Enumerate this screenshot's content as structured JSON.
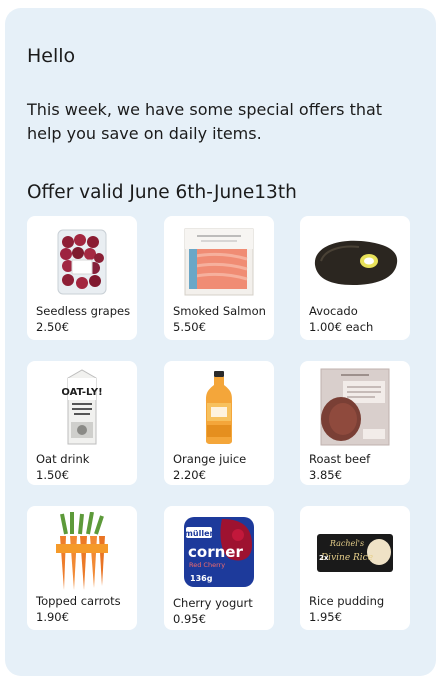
{
  "header": {
    "greeting": "Hello",
    "intro": "This week, we have some special offers that help you save on daily items.",
    "validity": "Offer valid June 6th-June13th"
  },
  "products": [
    {
      "name": "Seedless grapes",
      "price": "2.50€",
      "icon": "grapes-punnet-icon"
    },
    {
      "name": "Smoked Salmon",
      "price": "5.50€",
      "icon": "salmon-pack-icon"
    },
    {
      "name": "Avocado",
      "price": "1.00€ each",
      "icon": "avocado-icon"
    },
    {
      "name": "Oat drink",
      "price": "1.50€",
      "icon": "oat-drink-carton-icon",
      "brand_text": "OAT-LY!"
    },
    {
      "name": "Orange juice",
      "price": "2.20€",
      "icon": "juice-bottle-icon"
    },
    {
      "name": "Roast beef",
      "price": "3.85€",
      "icon": "roast-beef-pack-icon"
    },
    {
      "name": "Topped carrots",
      "price": "1.90€",
      "icon": "carrots-bundle-icon"
    },
    {
      "name": "Cherry yogurt",
      "price": "0.95€",
      "icon": "yogurt-pot-icon",
      "brand_text": "müller",
      "product_text": "corner",
      "flavour_text": "Red Cherry",
      "weight_text": "136g"
    },
    {
      "name": "Rice pudding",
      "price": "1.95€",
      "icon": "rice-pudding-pots-icon",
      "brand_text": "Rachel's",
      "product_text": "Divine Rice",
      "multi_text": "2x"
    }
  ],
  "colors": {
    "panel": "#e6f0f8",
    "card": "#ffffff",
    "text": "#1b1b1b"
  }
}
